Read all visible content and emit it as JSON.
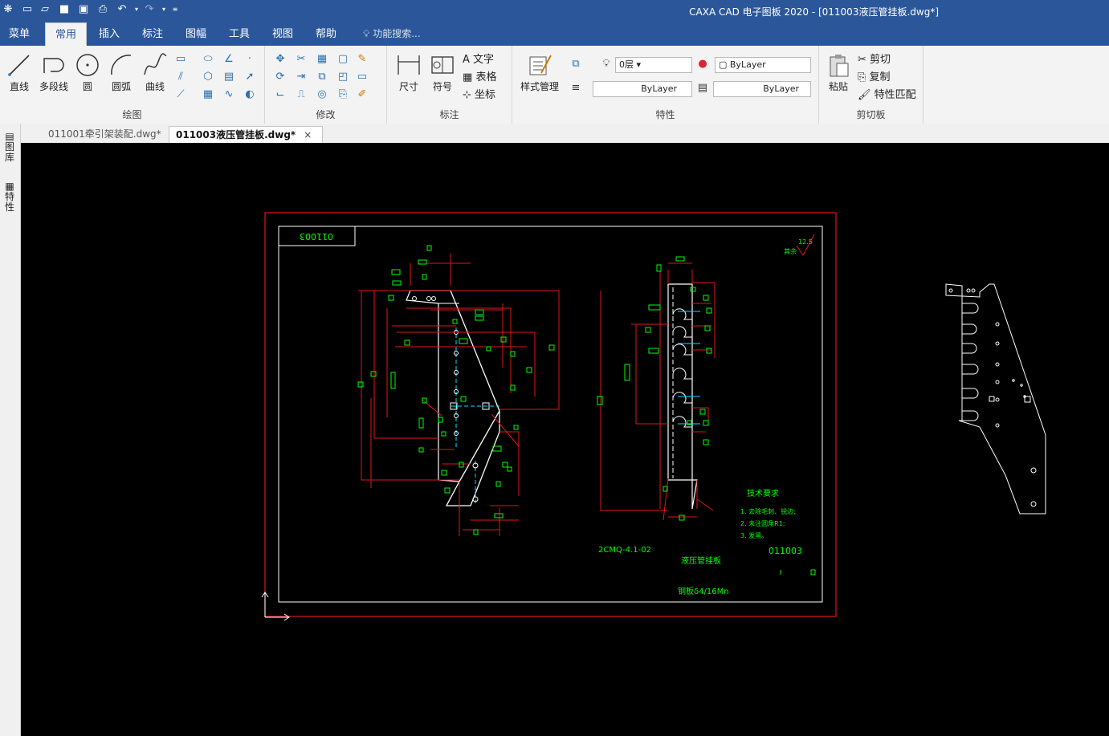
{
  "window_title": "CAXA CAD 电子图板 2020 - [011003液压管挂板.dwg*]",
  "menu_tabs": [
    "菜单",
    "常用",
    "插入",
    "标注",
    "图幅",
    "工具",
    "视图",
    "帮助"
  ],
  "active_tab": "常用",
  "search_placeholder": "功能搜索...",
  "ribbon": {
    "draw": {
      "label": "绘图",
      "buttons": [
        "直线",
        "多段线",
        "圆",
        "圆弧",
        "曲线"
      ]
    },
    "modify": {
      "label": "修改"
    },
    "annotate": {
      "label": "标注",
      "buttons": [
        "尺寸",
        "符号"
      ],
      "small": [
        "文字",
        "表格",
        "坐标"
      ]
    },
    "properties": {
      "label": "特性",
      "style_button": "样式管理",
      "layer": "0层",
      "color": "ByLayer",
      "linetype": "ByLayer",
      "lineweight": "ByLayer"
    },
    "clipboard": {
      "label": "剪切板",
      "paste": "粘贴",
      "cut": "剪切",
      "copy": "复制",
      "match": "特性匹配"
    }
  },
  "doc_tabs": [
    {
      "label": "011001牵引架装配.dwg*",
      "active": false
    },
    {
      "label": "011003液压管挂板.dwg*",
      "active": true
    }
  ],
  "doc_tab_close": "×",
  "side_panels": [
    "图库",
    "特性"
  ],
  "drawing": {
    "code_box": "011003",
    "roughness": "12.5",
    "roughness_note": "其余",
    "tech_title": "技术要求",
    "tech_items": [
      "1. 去除毛刺、锐边;",
      "2. 未注圆角R1;",
      "3. 发黑。"
    ],
    "project_code": "2CMQ-4.1-02",
    "part_name": "液压管挂板",
    "part_no": "011003",
    "material": "钢板δ4/16Mn"
  },
  "colors": {
    "border_red": "#e0161b",
    "white": "#ffffff",
    "green": "#00ff00",
    "cyan": "#00e5ff",
    "accent": "#2b579a"
  }
}
